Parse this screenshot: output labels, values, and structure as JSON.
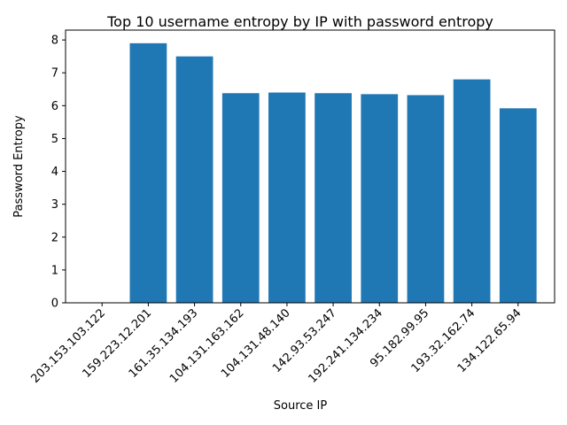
{
  "chart_data": {
    "type": "bar",
    "title": "Top 10 username entropy by IP with password entropy",
    "xlabel": "Source IP",
    "ylabel": "Password Entropy",
    "categories": [
      "203.153.103.122",
      "159.223.12.201",
      "161.35.134.193",
      "104.131.163.162",
      "104.131.48.140",
      "142.93.53.247",
      "192.241.134.234",
      "95.182.99.95",
      "193.32.162.74",
      "134.122.65.94"
    ],
    "values": [
      0,
      7.9,
      7.5,
      6.38,
      6.4,
      6.38,
      6.35,
      6.32,
      6.8,
      5.92
    ],
    "ylim": [
      0,
      8.3
    ],
    "yticks": [
      0,
      1,
      2,
      3,
      4,
      5,
      6,
      7,
      8
    ],
    "grid": false,
    "bar_color": "#1f77b4"
  }
}
